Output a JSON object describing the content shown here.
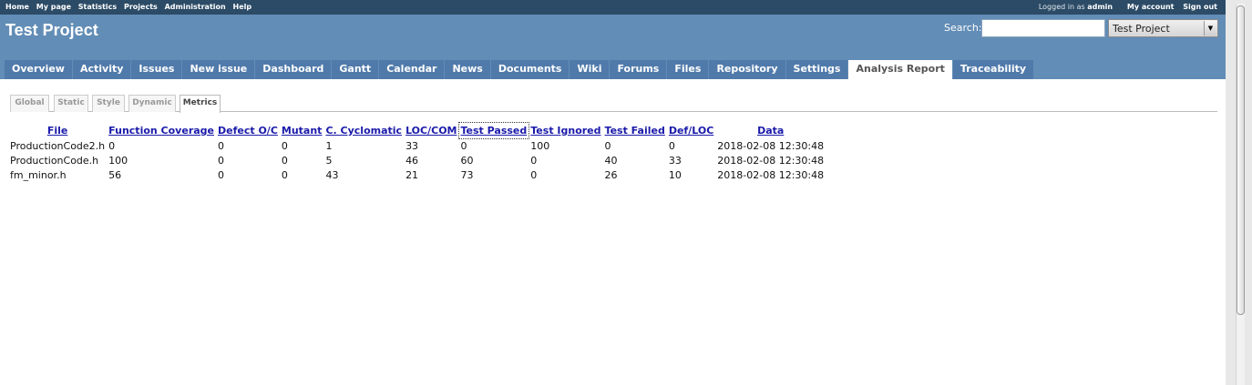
{
  "top_menu": {
    "left": [
      "Home",
      "My page",
      "Statistics",
      "Projects",
      "Administration",
      "Help"
    ],
    "logged_in_prefix": "Logged in as",
    "user": "admin",
    "my_account": "My account",
    "sign_out": "Sign out"
  },
  "header": {
    "title": "Test Project",
    "search_label": "Search:",
    "search_value": "",
    "project_select": "Test Project"
  },
  "main_menu": [
    {
      "label": "Overview"
    },
    {
      "label": "Activity"
    },
    {
      "label": "Issues"
    },
    {
      "label": "New issue"
    },
    {
      "label": "Dashboard"
    },
    {
      "label": "Gantt"
    },
    {
      "label": "Calendar"
    },
    {
      "label": "News"
    },
    {
      "label": "Documents"
    },
    {
      "label": "Wiki"
    },
    {
      "label": "Forums"
    },
    {
      "label": "Files"
    },
    {
      "label": "Repository"
    },
    {
      "label": "Settings"
    },
    {
      "label": "Analysis Report",
      "selected": true
    },
    {
      "label": "Traceability"
    }
  ],
  "subtabs": [
    "Global",
    "Static",
    "Style",
    "Dynamic",
    "Metrics"
  ],
  "subtab_selected": "Metrics",
  "table": {
    "headers": [
      "File",
      "Function Coverage",
      "Defect O/C",
      "Mutant",
      "C. Cyclomatic",
      "LOC/COM",
      "Test Passed",
      "Test Ignored",
      "Test Failed",
      "Def/LOC",
      "Data"
    ],
    "rows": [
      [
        "ProductionCode2.h",
        "0",
        "0",
        "0",
        "1",
        "33",
        "0",
        "100",
        "0",
        "0",
        "2018-02-08 12:30:48"
      ],
      [
        "ProductionCode.h",
        "100",
        "0",
        "0",
        "5",
        "46",
        "60",
        "0",
        "40",
        "33",
        "2018-02-08 12:30:48"
      ],
      [
        "fm_minor.h",
        "56",
        "0",
        "0",
        "43",
        "21",
        "73",
        "0",
        "26",
        "10",
        "2018-02-08 12:30:48"
      ]
    ]
  }
}
